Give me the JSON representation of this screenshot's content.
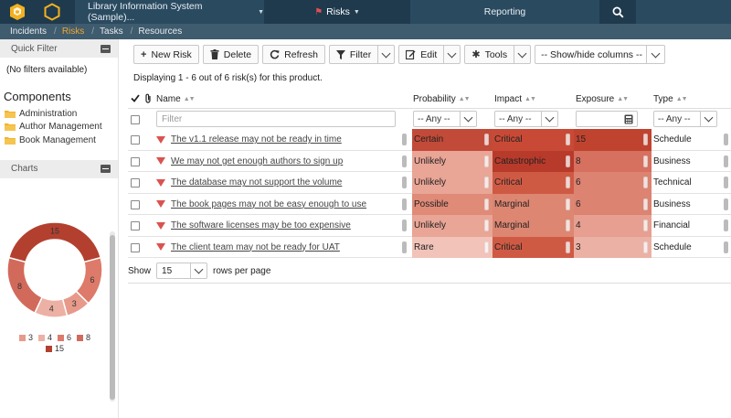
{
  "topbar": {
    "product": "Library Information System (Sample)...",
    "risks": "Risks",
    "reporting": "Reporting"
  },
  "subnav": {
    "items": [
      "Incidents",
      "Risks",
      "Tasks",
      "Resources"
    ],
    "active": "Risks"
  },
  "quick_filter": {
    "title": "Quick Filter",
    "empty": "(No filters available)"
  },
  "components": {
    "title": "Components",
    "items": [
      "Administration",
      "Author Management",
      "Book Management"
    ]
  },
  "charts": {
    "title": "Charts",
    "donut": [
      {
        "label": "6",
        "value": 6,
        "color": "#dd7a6a"
      },
      {
        "label": "3",
        "value": 3,
        "color": "#e79a8a"
      },
      {
        "label": "4",
        "value": 4,
        "color": "#edb0a4"
      },
      {
        "label": "8",
        "value": 8,
        "color": "#d26a5c"
      },
      {
        "label": "15",
        "value": 15,
        "color": "#b3402f"
      }
    ],
    "legend": [
      "3",
      "4",
      "6",
      "8",
      "15"
    ]
  },
  "toolbar": {
    "new_risk": "New Risk",
    "delete": "Delete",
    "refresh": "Refresh",
    "filter": "Filter",
    "edit": "Edit",
    "tools": "Tools",
    "show_hide": "-- Show/hide columns --"
  },
  "displaying": "Displaying 1 - 6 out of 6 risk(s) for this product.",
  "columns": {
    "name": "Name",
    "probability": "Probability",
    "impact": "Impact",
    "exposure": "Exposure",
    "type": "Type"
  },
  "filters": {
    "name_placeholder": "Filter",
    "any": "-- Any --"
  },
  "rows": [
    {
      "name": "The v1.1 release may not be ready in time",
      "probability": "Certain",
      "impact": "Critical",
      "exposure": "15",
      "type": "Schedule",
      "pcolor": "#c24a38",
      "icolor": "#c84a36",
      "ecolor": "#c0432f"
    },
    {
      "name": "We may not get enough authors to sign up",
      "probability": "Unlikely",
      "impact": "Catastrophic",
      "exposure": "8",
      "type": "Business",
      "pcolor": "#e9a596",
      "icolor": "#b83a2b",
      "ecolor": "#d6705f"
    },
    {
      "name": "The database may not support the volume",
      "probability": "Unlikely",
      "impact": "Critical",
      "exposure": "6",
      "type": "Technical",
      "pcolor": "#e9a596",
      "icolor": "#cf5a44",
      "ecolor": "#dc8371"
    },
    {
      "name": "The book pages may not be easy enough to use",
      "probability": "Possible",
      "impact": "Marginal",
      "exposure": "6",
      "type": "Business",
      "pcolor": "#e08a78",
      "icolor": "#dd8672",
      "ecolor": "#dc8371"
    },
    {
      "name": "The software licenses may be too expensive",
      "probability": "Unlikely",
      "impact": "Marginal",
      "exposure": "4",
      "type": "Financial",
      "pcolor": "#e9a596",
      "icolor": "#dd8672",
      "ecolor": "#e69f90"
    },
    {
      "name": "The client team may not be ready for UAT",
      "probability": "Rare",
      "impact": "Critical",
      "exposure": "3",
      "type": "Schedule",
      "pcolor": "#f1c3b9",
      "icolor": "#cf5a44",
      "ecolor": "#ebb1a5"
    }
  ],
  "pagination": {
    "show": "Show",
    "per_page": "15",
    "rows_per_page": "rows per page"
  }
}
